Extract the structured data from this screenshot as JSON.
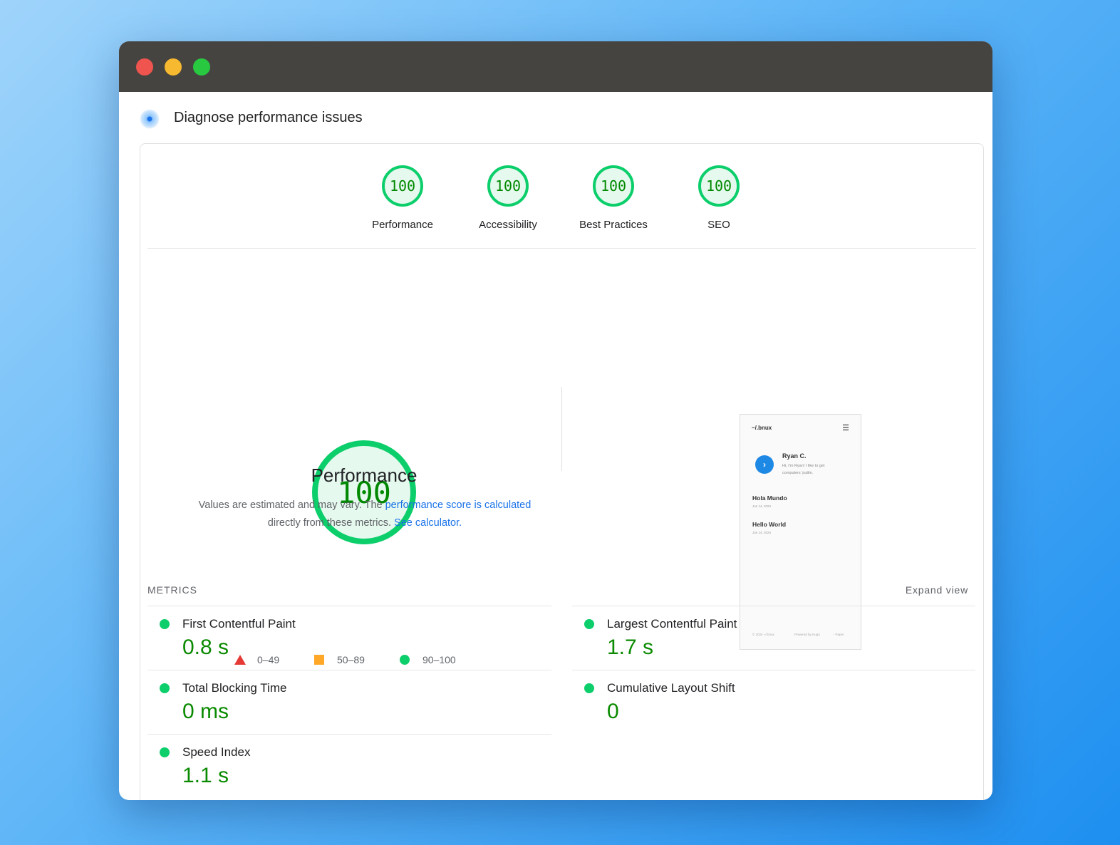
{
  "window": {
    "title": "Diagnose performance issues",
    "traffic_colors": [
      "#f0544f",
      "#f6b92f",
      "#28c840"
    ]
  },
  "categories": [
    {
      "score": "100",
      "label": "Performance"
    },
    {
      "score": "100",
      "label": "Accessibility"
    },
    {
      "score": "100",
      "label": "Best Practices"
    },
    {
      "score": "100",
      "label": "SEO"
    }
  ],
  "performance": {
    "score": "100",
    "title": "Performance",
    "desc_prefix": "Values are estimated and may vary. The ",
    "desc_link": "performance score is calculated",
    "desc_mid": "directly from these metrics. ",
    "calc_link": "See calculator."
  },
  "legend": [
    {
      "icon": "triangle-icon",
      "range": "0–49",
      "color": "#e53935"
    },
    {
      "icon": "square-icon",
      "range": "50–89",
      "color": "#ffa726"
    },
    {
      "icon": "circle-icon",
      "range": "90–100",
      "color": "#0cce6b"
    }
  ],
  "thumbnail": {
    "site": "~/.bnux",
    "name": "Ryan C.",
    "bio": "Hi, I'm Ryan! I like to get computers 'puttin.",
    "posts": [
      {
        "title": "Hola Mundo",
        "date": "Jun 14, 2024"
      },
      {
        "title": "Hello World",
        "date": "Jun 14, 2024"
      }
    ],
    "footer": [
      "© 2024 ~/.bnux",
      "Powered by Hugo",
      "↑ Paper"
    ]
  },
  "metrics": {
    "heading": "METRICS",
    "expand": "Expand view",
    "items": [
      {
        "title": "First Contentful Paint",
        "value": "0.8 s"
      },
      {
        "title": "Largest Contentful Paint",
        "value": "1.7 s"
      },
      {
        "title": "Total Blocking Time",
        "value": "0 ms"
      },
      {
        "title": "Cumulative Layout Shift",
        "value": "0"
      },
      {
        "title": "Speed Index",
        "value": "1.1 s"
      }
    ]
  }
}
